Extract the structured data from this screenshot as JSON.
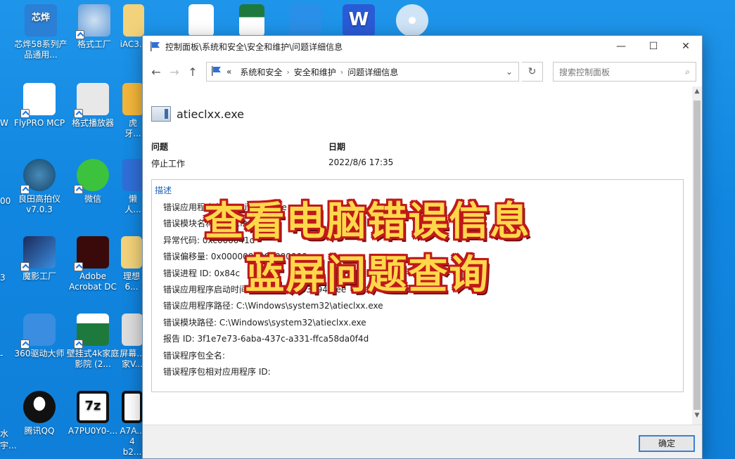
{
  "desktop": {
    "icons": [
      {
        "label": "芯烨58系列产品通用...",
        "color": "#2b7fd4",
        "icon": "xinye-logo-icon",
        "badge": "芯烨"
      },
      {
        "label": "格式工厂",
        "color": "#6aa0d8",
        "icon": "format-factory-icon"
      },
      {
        "label": "iAC3...",
        "color": "#f2d27a",
        "icon": "folder-icon"
      },
      {
        "label": "FlyPRO MCP",
        "color": "#ffffff",
        "icon": "flypro-icon"
      },
      {
        "label": "格式播放器",
        "color": "#e8e8e8",
        "icon": "format-player-icon"
      },
      {
        "label": "虎牙...",
        "color": "#f3b63a",
        "icon": "huya-icon"
      },
      {
        "label": "良田高拍仪 v7.0.3",
        "color": "#12466a",
        "icon": "liangtian-icon"
      },
      {
        "label": "微信",
        "color": "#3cc23c",
        "icon": "wechat-icon"
      },
      {
        "label": "懒人...",
        "color": "#2f6fd6",
        "icon": "lazy-icon"
      },
      {
        "label": "魔影工厂",
        "color": "#1d2a5a",
        "icon": "moying-icon"
      },
      {
        "label": "Adobe Acrobat DC",
        "color": "#3a0a0a",
        "icon": "acrobat-icon"
      },
      {
        "label": "理想6...",
        "color": "#f2d27a",
        "icon": "folder-icon"
      },
      {
        "label": "360驱动大师",
        "color": "#3a8de0",
        "icon": "360-driver-icon"
      },
      {
        "label": "壁挂式4k家庭影院 (2...",
        "color": "#1e7a3c",
        "icon": "excel-icon"
      },
      {
        "label": "屏幕...家V...",
        "color": "#dddddd",
        "icon": "screen-icon"
      },
      {
        "label": "腾讯QQ",
        "color": "#111111",
        "icon": "qq-icon"
      },
      {
        "label": "A7PU0Y0-...",
        "color": "#111111",
        "icon": "7zip-icon"
      },
      {
        "label": "A7A... 4 b2...",
        "color": "#111111",
        "icon": "7zip-icon"
      }
    ],
    "top_row": [
      {
        "icon": "word-doc-icon",
        "color": "#ffffff"
      },
      {
        "icon": "excel-doc-icon",
        "color": "#ffffff"
      },
      {
        "icon": "bird-app-icon",
        "color": "#2a8fe8"
      },
      {
        "icon": "wps-word-icon",
        "color": "#2a5bd6"
      },
      {
        "icon": "disc-icon",
        "color": "#cfe4f7"
      }
    ],
    "left_partials": [
      "W",
      "00",
      "3",
      "-",
      "水 宇..."
    ]
  },
  "window": {
    "title": "控制面板\\系统和安全\\安全和维护\\问题详细信息",
    "minimize": "—",
    "maximize": "☐",
    "close": "✕",
    "nav": {
      "back": "←",
      "forward": "→",
      "up": "↑",
      "chev": "«",
      "crumbs": [
        "系统和安全",
        "安全和维护",
        "问题详细信息"
      ],
      "sep": "›",
      "dropdown": "⌄",
      "refresh": "↻"
    },
    "search": {
      "placeholder": "搜索控制面板",
      "icon": "⌕"
    },
    "app_name": "atieclxx.exe",
    "problem_header": "问题",
    "problem_value": "停止工作",
    "date_header": "日期",
    "date_value": "2022/8/6 17:35",
    "description_label": "描述",
    "description_rows": [
      "错误应用程序名称: atieclxx.exe",
      "错误模块名称: atieclxx.exe",
      "异常代码: 0xc000041d",
      "错误偏移量: 0x0000000000000000",
      "错误进程 ID: 0x84c",
      "错误应用程序启动时间: 0x01d8a9363294feee",
      "错误应用程序路径: C:\\Windows\\system32\\atieclxx.exe",
      "错误模块路径: C:\\Windows\\system32\\atieclxx.exe",
      "报告 ID: 3f1e7e73-6aba-437c-a331-ffca58da0f4d",
      "错误程序包全名:",
      "错误程序包相对应用程序 ID:"
    ],
    "ok_button": "确定"
  },
  "overlay": {
    "line1": "查看电脑错误信息",
    "line2": "蓝屏问题查询"
  },
  "colors": {
    "overlay_text": "#ffd84a",
    "overlay_outline": "#c0191a",
    "desktop": "#1a8fe6",
    "link": "#1a5fb4"
  }
}
